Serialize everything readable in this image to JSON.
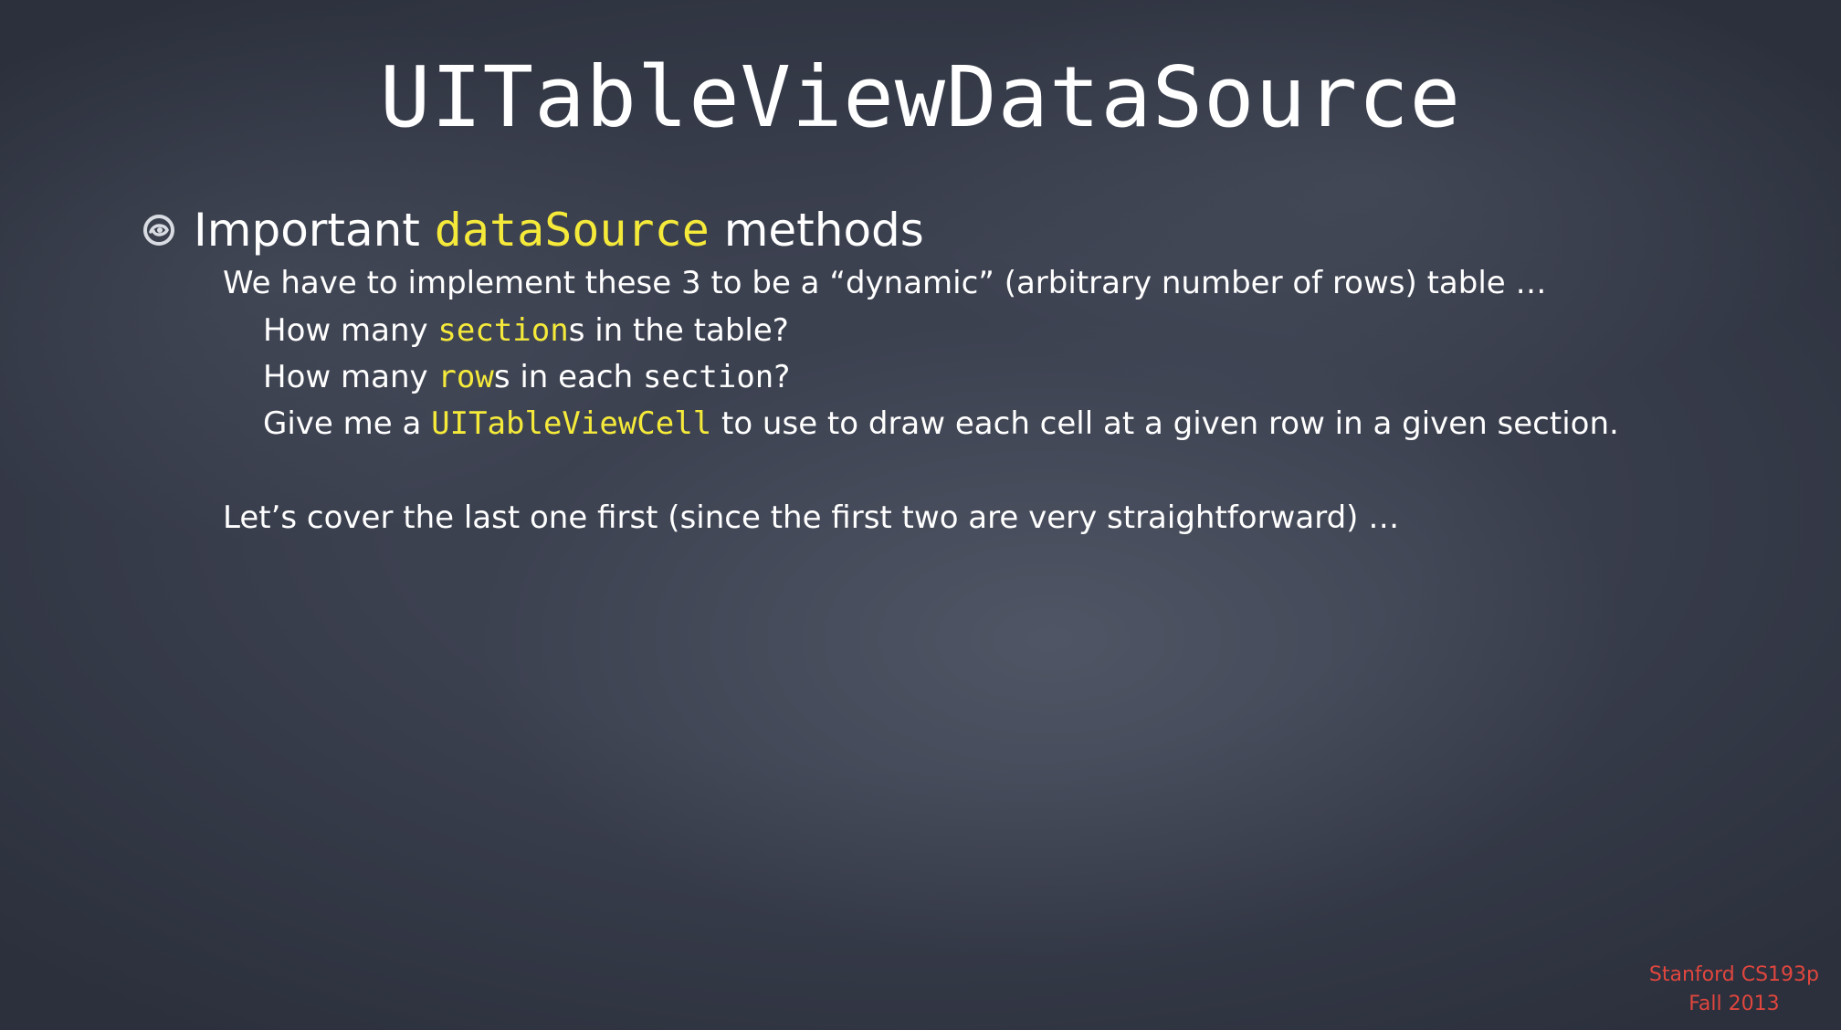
{
  "slide": {
    "title": "UITableViewDataSource",
    "bullet": {
      "icon": "bullet-swirl-icon",
      "prefix": "Important ",
      "highlight": "dataSource",
      "suffix": " methods"
    },
    "lines": {
      "intro": "We have to implement these 3 to be a “dynamic” (arbitrary number of rows) table …",
      "q1": {
        "before": "How many ",
        "highlight": "section",
        "after": "s in the table?"
      },
      "q2": {
        "before": "How many ",
        "highlight": "row",
        "after_plain": "s in each ",
        "after_mono": "section",
        "end": "?"
      },
      "q3": {
        "before": "Give me a ",
        "highlight": "UITableViewCell",
        "after": " to use to draw each cell at a given row in a given section."
      },
      "closing": "Let’s cover the last one first (since the first two are very straightforward) …"
    },
    "footer": {
      "line1": "Stanford CS193p",
      "line2": "Fall 2013"
    },
    "colors": {
      "background": "#3c4150",
      "text": "#ffffff",
      "highlight": "#f5ea3a",
      "footer": "#e0463e"
    }
  }
}
